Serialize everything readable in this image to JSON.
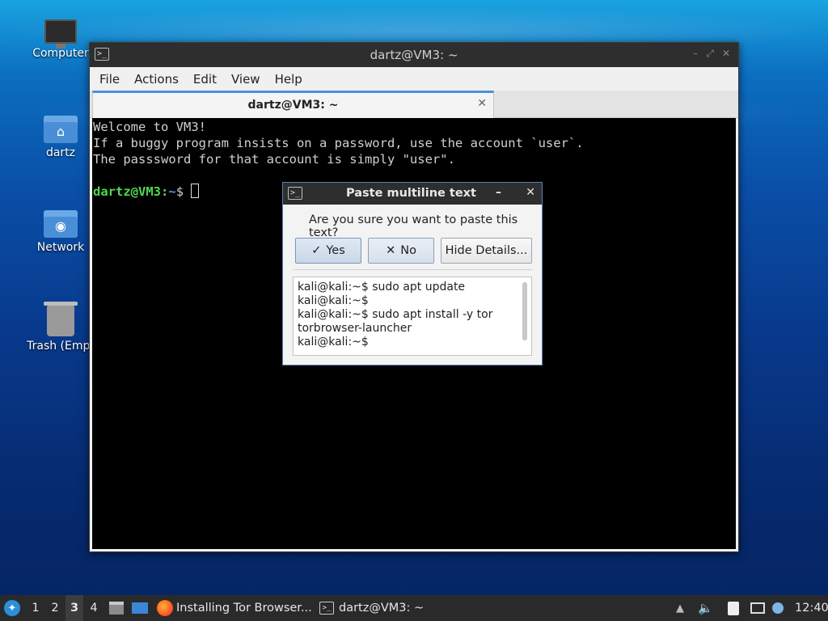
{
  "desktop": {
    "icons": [
      {
        "label": "Computer",
        "icon": "computer-icon"
      },
      {
        "label": "dartz",
        "icon": "home-folder-icon"
      },
      {
        "label": "Network",
        "icon": "network-folder-icon"
      },
      {
        "label": "Trash (Empt",
        "icon": "trash-icon"
      }
    ]
  },
  "terminal": {
    "window_title": "dartz@VM3: ~",
    "menu": [
      "File",
      "Actions",
      "Edit",
      "View",
      "Help"
    ],
    "tab_title": "dartz@VM3: ~",
    "output_lines": [
      "Welcome to VM3!",
      "If a buggy program insists on a password, use the account `user`.",
      "The passsword for that account is simply \"user\"."
    ],
    "prompt": {
      "user_host": "dartz@VM3",
      "sep": ":",
      "path": "~",
      "symbol": "$"
    }
  },
  "dialog": {
    "title": "Paste multiline text",
    "question": "Are you sure you want to paste this text?",
    "buttons": {
      "yes": "Yes",
      "no": "No",
      "hide": "Hide Details..."
    },
    "text_lines": [
      "kali@kali:~$ sudo apt update",
      "kali@kali:~$",
      "kali@kali:~$ sudo apt install -y tor",
      "torbrowser-launcher",
      "kali@kali:~$"
    ]
  },
  "taskbar": {
    "workspaces": [
      "1",
      "2",
      "3",
      "4"
    ],
    "active_workspace": "3",
    "tasks": [
      {
        "label": "Installing Tor Browser...",
        "icon": "firefox-icon"
      },
      {
        "label": "dartz@VM3: ~",
        "icon": "terminal-icon"
      }
    ],
    "clock": "12:40"
  },
  "colors": {
    "prompt_user": "#4fd84f",
    "prompt_path": "#5b8cff",
    "accent": "#4a90d9"
  }
}
